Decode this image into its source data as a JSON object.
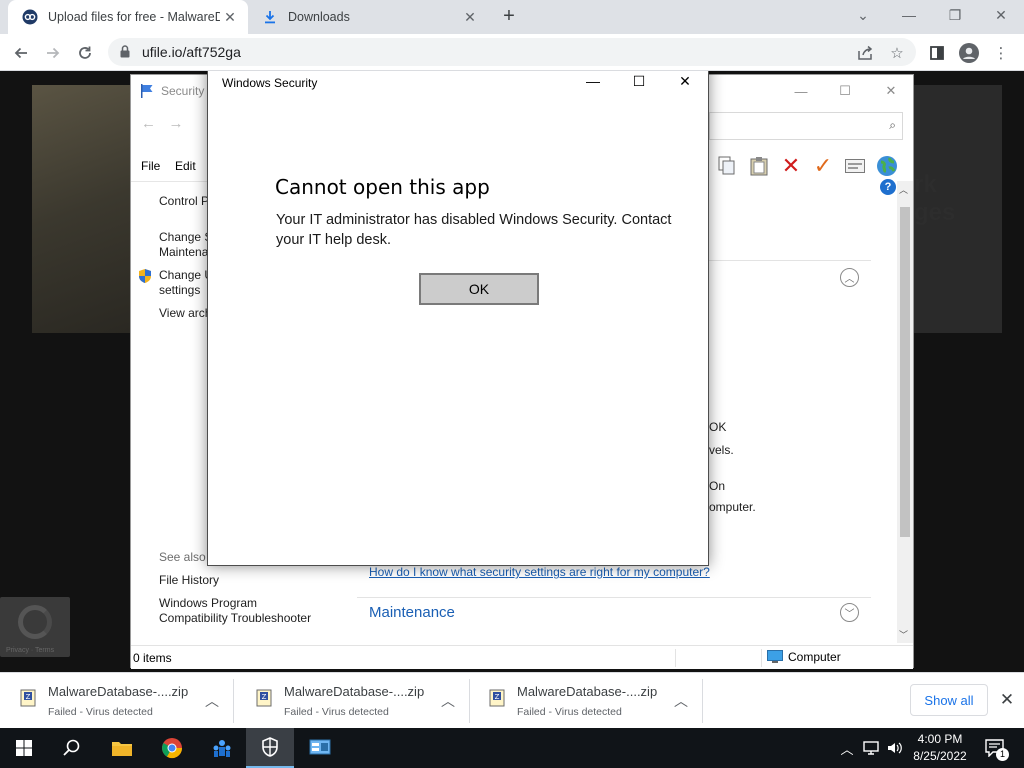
{
  "browser": {
    "tabs": [
      {
        "title": "Upload files for free - MalwareDatabase",
        "active": true,
        "icon": "ufile-favicon"
      },
      {
        "title": "Downloads",
        "active": false,
        "icon": "download-icon"
      }
    ],
    "new_tab_label": "+",
    "url": "ufile.io/aft752ga"
  },
  "control_panel": {
    "title": "Security and Maintenance",
    "menu": {
      "file": "File",
      "edit": "Edit"
    },
    "sidebar": {
      "control_panel_home": "Control Panel Home",
      "change_settings_line1": "Change Security and",
      "change_settings_line2": "Maintenance settings",
      "change_uac_line1": "Change User Account Control",
      "change_uac_line2": "settings",
      "view_archived": "View archived messages",
      "see_also": "See also",
      "file_history": "File History",
      "compat_line1": "Windows Program",
      "compat_line2": "Compatibility Troubleshooter"
    },
    "main": {
      "frag_ok": "OK",
      "frag_levels": "vels.",
      "frag_on": "On",
      "frag_computer": "omputer.",
      "help_link": "How do I know what security settings are right for my computer?",
      "maintenance": "Maintenance"
    },
    "status": {
      "items": "0 items",
      "location": "Computer"
    }
  },
  "dialog": {
    "window_title": "Windows Security",
    "heading": "Cannot open this app",
    "message": "Your IT administrator has disabled Windows Security. Contact your IT help desk.",
    "ok_label": "OK"
  },
  "downloads": {
    "items": [
      {
        "name": "MalwareDatabase-....zip",
        "status": "Failed - Virus detected"
      },
      {
        "name": "MalwareDatabase-....zip",
        "status": "Failed - Virus detected"
      },
      {
        "name": "MalwareDatabase-....zip",
        "status": "Failed - Virus detected"
      }
    ],
    "show_all": "Show all"
  },
  "taskbar": {
    "time": "4:00 PM",
    "date": "8/25/2022",
    "notification_count": "1"
  },
  "colors": {
    "accent": "#1a73e8",
    "error_red": "#d01c1c",
    "link_blue": "#1a5fb4"
  }
}
